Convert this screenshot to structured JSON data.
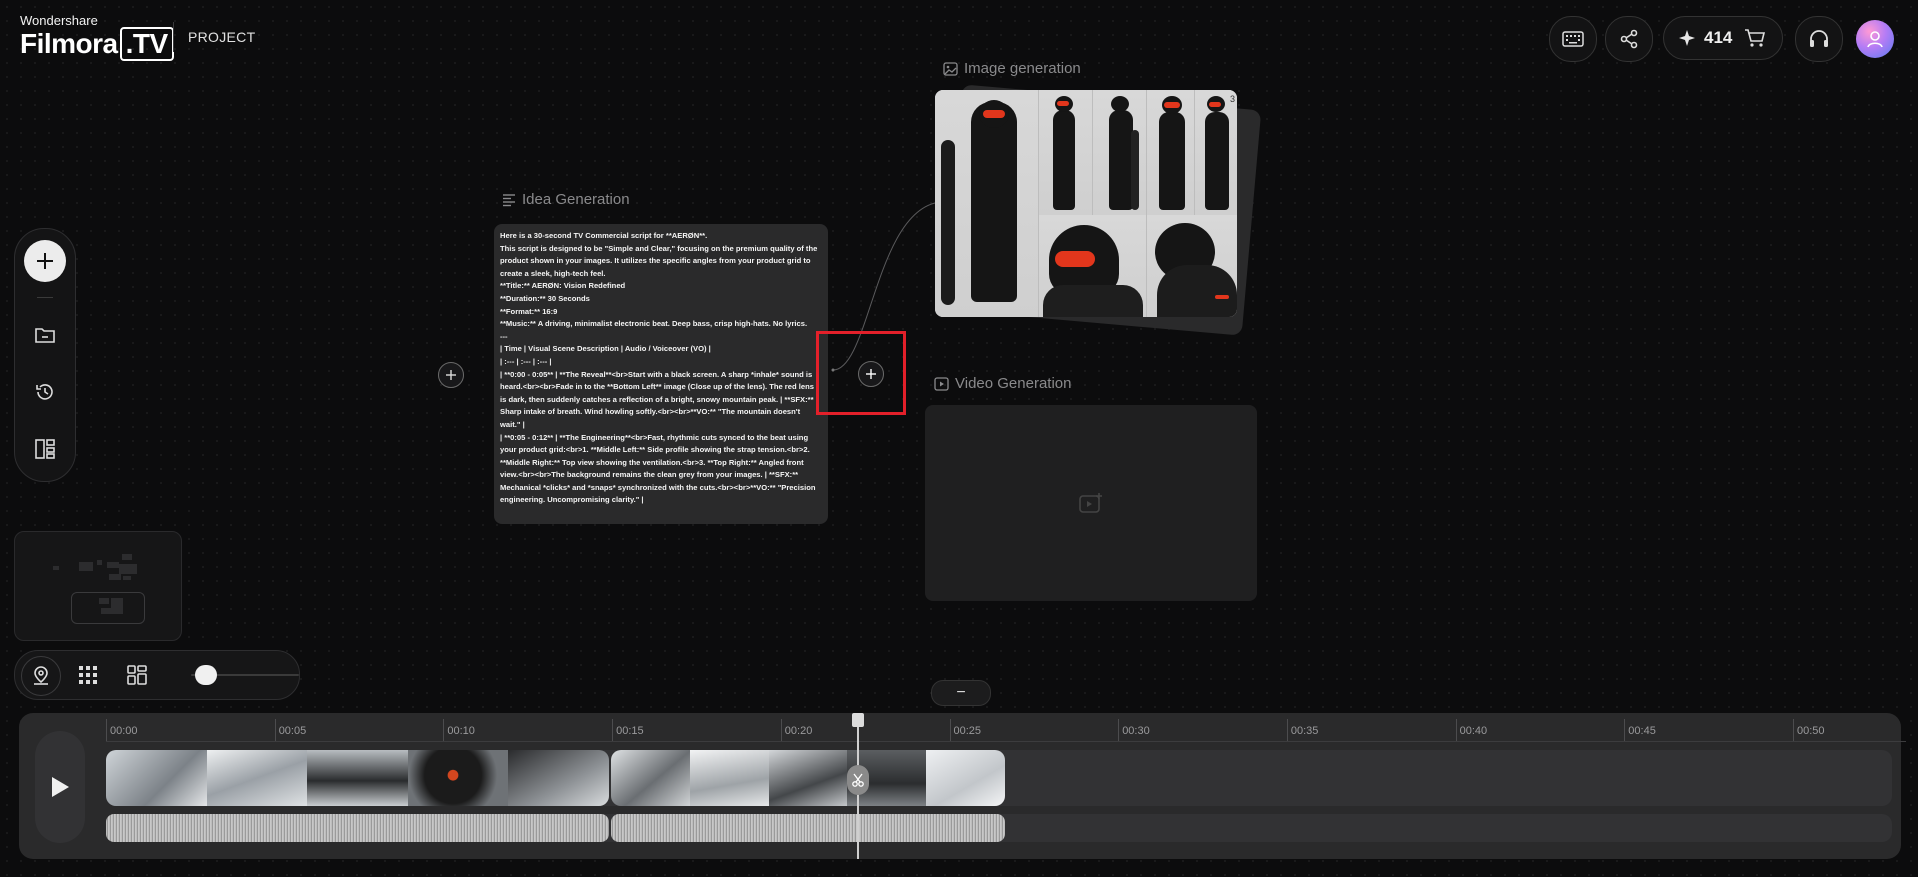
{
  "header": {
    "brand_small": "Wondershare",
    "brand_main": "Filmora",
    "brand_suffix": ".TV",
    "section": "PROJECT",
    "credits": "414",
    "icons": [
      "keyboard-icon",
      "share-icon",
      "sparkle-icon",
      "cart-icon",
      "headset-icon",
      "avatar"
    ]
  },
  "left_toolbar": {
    "icons": [
      "add-icon",
      "folder-icon",
      "history-icon",
      "layout-icon"
    ]
  },
  "bottom_controls": {
    "icons": [
      "location-icon",
      "grid-icon",
      "layout-grid-icon"
    ],
    "zoom_slider_value": 0.1
  },
  "nodes": {
    "idea": {
      "title": "Idea Generation",
      "lines": [
        "Here is a 30-second TV Commercial script for **AERØN**.",
        "This script is designed to be \"Simple and Clear,\" focusing on the premium quality of the product shown in your images. It utilizes the specific angles from your product grid to create a sleek, high-tech feel.",
        "**Title:** AERØN: Vision Redefined",
        "**Duration:** 30 Seconds",
        "**Format:** 16:9",
        "**Music:** A driving, minimalist electronic beat. Deep bass, crisp high-hats. No lyrics.",
        "---",
        "| Time | Visual Scene Description | Audio / Voiceover (VO) |",
        "| :--- | :--- | :--- |",
        "| **0:00 - 0:05** | **The Reveal**<br>Start with a black screen. A sharp *inhale* sound is heard.<br><br>Fade in to the **Bottom Left** image (Close up of the lens). The red lens is dark, then suddenly catches a reflection of a bright, snowy mountain peak. | **SFX:** Sharp intake of breath. Wind howling softly.<br><br>**VO:** \"The mountain doesn't wait.\" |",
        "| **0:05 - 0:12** | **The Engineering**<br>Fast, rhythmic cuts synced to the beat using your product grid:<br>1. **Middle Left:** Side profile showing the strap tension.<br>2. **Middle Right:** Top view showing the ventilation.<br>3. **Top Right:** Angled front view.<br><br>The background remains the clean grey from your images. | **SFX:** Mechanical *clicks* and *snaps* synchronized with the cuts.<br><br>**VO:** \"Precision engineering. Uncompromising clarity.\" |"
      ]
    },
    "image": {
      "title": "Image generation",
      "badge": "3"
    },
    "video": {
      "title": "Video Generation"
    }
  },
  "minus_label": "−",
  "timeline": {
    "ticks": [
      "00:00",
      "00:05",
      "00:10",
      "00:15",
      "00:20",
      "00:25",
      "00:30",
      "00:35",
      "00:40",
      "00:45",
      "00:50"
    ],
    "playhead": "00:22"
  },
  "colors": {
    "accent_red": "#e3202a",
    "visor": "#e2361c"
  }
}
